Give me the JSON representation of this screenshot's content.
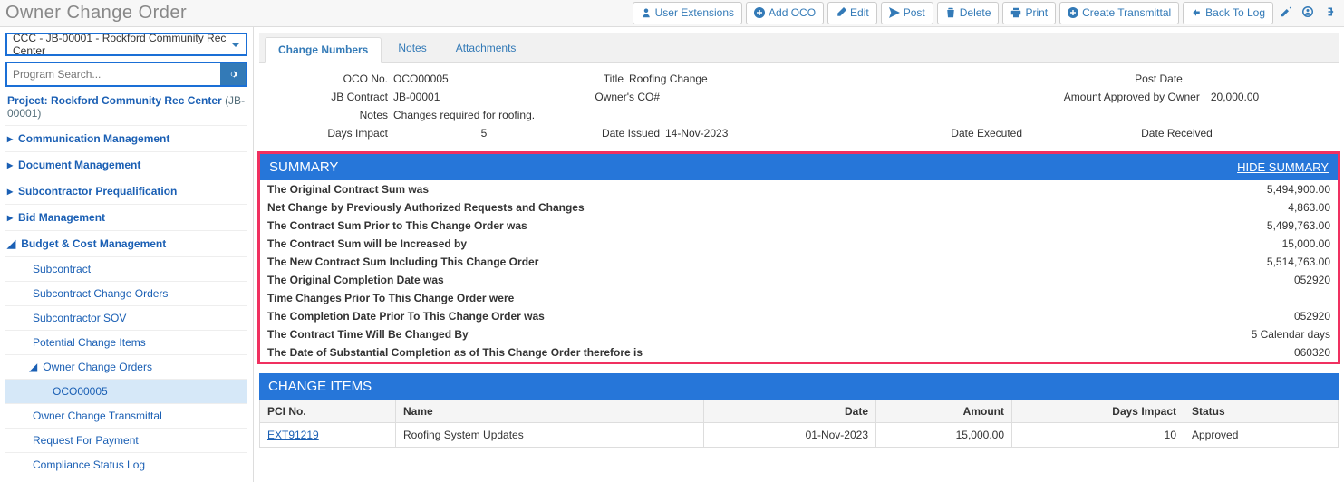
{
  "header": {
    "title": "Owner Change Order",
    "buttons": {
      "user_ext": "User Extensions",
      "add_oco": "Add OCO",
      "edit": "Edit",
      "post": "Post",
      "delete": "Delete",
      "print": "Print",
      "create_transmittal": "Create Transmittal",
      "back_to_log": "Back To Log"
    }
  },
  "sidebar": {
    "project_select": "CCC - JB-00001 - Rockford Community Rec Center",
    "search_placeholder": "Program Search...",
    "project_label": "Project: Rockford Community Rec Center",
    "project_code": "(JB-00001)",
    "groups": {
      "comm": "Communication Management",
      "doc": "Document Management",
      "subq": "Subcontractor Prequalification",
      "bid": "Bid Management",
      "budget": "Budget & Cost Management"
    },
    "budget_items": {
      "subcontract": "Subcontract",
      "sco": "Subcontract Change Orders",
      "ssov": "Subcontractor SOV",
      "pci": "Potential Change Items",
      "oco": "Owner Change Orders",
      "oco_leaf": "OCO00005",
      "oct": "Owner Change Transmittal",
      "rfp": "Request For Payment",
      "csl": "Compliance Status Log"
    }
  },
  "tabs": {
    "change_numbers": "Change Numbers",
    "notes": "Notes",
    "attachments": "Attachments"
  },
  "form": {
    "oco_no_label": "OCO No.",
    "oco_no": "OCO00005",
    "title_label": "Title",
    "title": "Roofing Change",
    "post_date_label": "Post Date",
    "post_date": "",
    "jb_label": "JB Contract",
    "jb": "JB-00001",
    "owner_co_label": "Owner's CO#",
    "owner_co": "",
    "amt_label": "Amount Approved by Owner",
    "amt": "20,000.00",
    "notes_label": "Notes",
    "notes": "Changes required for roofing.",
    "days_label": "Days Impact",
    "days": "5",
    "issued_label": "Date Issued",
    "issued": "14-Nov-2023",
    "executed_label": "Date Executed",
    "executed": "",
    "received_label": "Date Received",
    "received": ""
  },
  "summary": {
    "title": "SUMMARY",
    "hide": "HIDE SUMMARY",
    "rows": [
      {
        "label": "The Original Contract Sum was",
        "value": "5,494,900.00"
      },
      {
        "label": "Net Change by Previously Authorized Requests and Changes",
        "value": "4,863.00"
      },
      {
        "label": "The Contract Sum Prior to This Change Order was",
        "value": "5,499,763.00"
      },
      {
        "label": "The Contract Sum will be Increased by",
        "value": "15,000.00"
      },
      {
        "label": "The New Contract Sum Including This Change Order",
        "value": "5,514,763.00"
      },
      {
        "label": "The Original Completion Date was",
        "value": "052920"
      },
      {
        "label": "Time Changes Prior To This Change Order were",
        "value": ""
      },
      {
        "label": "The Completion Date Prior To This Change Order was",
        "value": "052920"
      },
      {
        "label": "The Contract Time Will Be Changed By",
        "value": "5 Calendar days"
      },
      {
        "label": "The Date of Substantial Completion as of This Change Order therefore is",
        "value": "060320"
      }
    ]
  },
  "change_items": {
    "title": "CHANGE ITEMS",
    "headers": {
      "pci": "PCI No.",
      "name": "Name",
      "date": "Date",
      "amount": "Amount",
      "days": "Days Impact",
      "status": "Status"
    },
    "rows": [
      {
        "pci": "EXT91219",
        "name": "Roofing System Updates",
        "date": "01-Nov-2023",
        "amount": "15,000.00",
        "days": "10",
        "status": "Approved"
      }
    ]
  }
}
